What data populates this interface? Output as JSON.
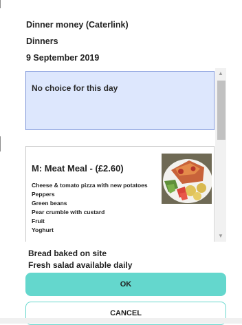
{
  "header": {
    "line1": "Dinner money (Caterlink)",
    "line2": "Dinners",
    "line3": "9 September 2019"
  },
  "choice_panel": {
    "no_choice_text": "No choice for this day",
    "meal": {
      "title": "M: Meat Meal - (£2.60)",
      "items": [
        "Cheese & tomato pizza with new potatoes",
        "Peppers",
        "Green beans",
        "Pear crumble with custard",
        "Fruit",
        "Yoghurt"
      ],
      "photo_icon": "meal-photo"
    },
    "scroll_up_icon": "chevron-up-icon",
    "scroll_down_icon": "chevron-down-icon"
  },
  "notes": {
    "line1": "Bread baked on site",
    "line2": "Fresh salad available daily"
  },
  "buttons": {
    "ok_label": "OK",
    "cancel_label": "CANCEL"
  },
  "colors": {
    "accent": "#64d7cd",
    "selected_bg": "#dde7fd",
    "selected_border": "#7d95d8"
  }
}
